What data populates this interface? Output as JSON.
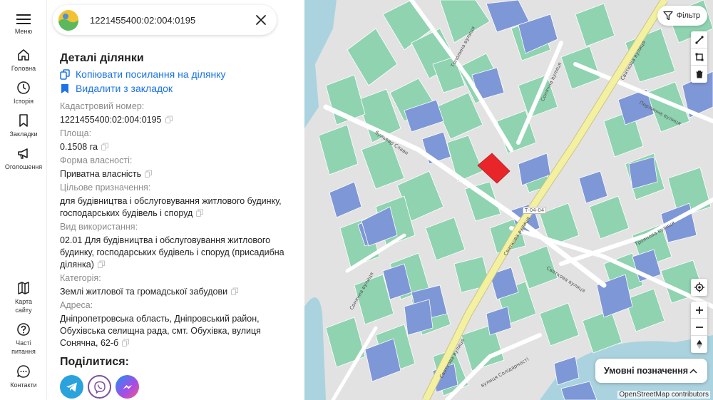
{
  "nav": {
    "menu": "Меню",
    "home": "Головна",
    "history": "Історія",
    "bookmarks": "Закладки",
    "announcements": "Оголошення",
    "site_map": "Карта сайту",
    "faq": "Часті питання",
    "contacts": "Контакти"
  },
  "search": {
    "value": "1221455400:02:004:0195"
  },
  "details": {
    "title": "Деталі ділянки",
    "copy_link": "Копіювати посилання на ділянку",
    "remove_bookmark": "Видалити з закладок",
    "fields": [
      {
        "label": "Кадастровий номер:",
        "value": "1221455400:02:004:0195"
      },
      {
        "label": "Площа:",
        "value": "0.1508 га"
      },
      {
        "label": "Форма власності:",
        "value": "Приватна власність"
      },
      {
        "label": "Цільове призначення:",
        "value": "для будівництва і обслуговування житлового будинку, господарських будівель і споруд"
      },
      {
        "label": "Вид використання:",
        "value": "02.01 Для будівництва і обслуговування житлового будинку, господарських будівель і споруд (присадибна ділянка)"
      },
      {
        "label": "Категорія:",
        "value": "Землі житлової та громадської забудови"
      },
      {
        "label": "Адреса:",
        "value": "Дніпропетровська область, Дніпровський район, Обухівська селищна рада, смт. Обухівка, вулиця Сонячна, 62-б"
      }
    ],
    "share_title": "Поділитися:"
  },
  "map": {
    "filter": "Фільтр",
    "legend": "Умовні позначення",
    "attribution": "OpenStreetMap contributors",
    "street_labels": [
      "Тополина вулиця",
      "Сонячна вулиця",
      "Святкова вулиця",
      "Перлинна вулиця",
      "бульвар Слави",
      "Т-04-04",
      "Святкова вулиця",
      "Святкова вулиця",
      "Троянова вулиця",
      "Сонячна вулиця",
      "Святкова вулиця",
      "вулиця Солідарності"
    ],
    "colors": {
      "parcel_green": "#8fd3b0",
      "parcel_blue": "#7e97d6",
      "selected": "#e8262a",
      "road_main": "#f3f1a0",
      "water": "#aad3df"
    }
  }
}
